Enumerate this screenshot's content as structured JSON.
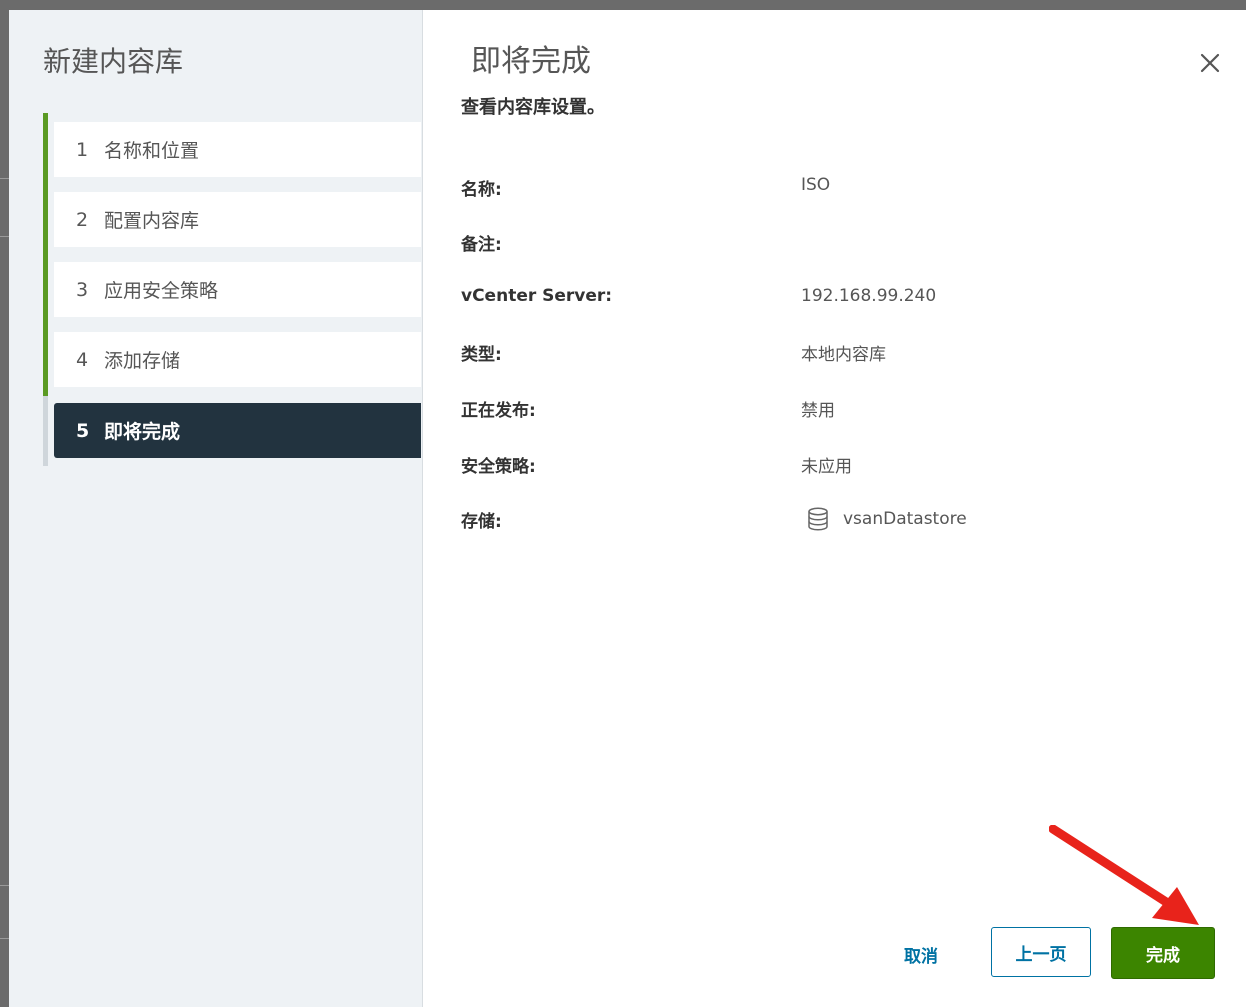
{
  "wizard": {
    "title": "新建内容库",
    "steps": [
      {
        "num": "1",
        "label": "名称和位置"
      },
      {
        "num": "2",
        "label": "配置内容库"
      },
      {
        "num": "3",
        "label": "应用安全策略"
      },
      {
        "num": "4",
        "label": "添加存储"
      },
      {
        "num": "5",
        "label": "即将完成"
      }
    ],
    "active_step": 5
  },
  "content": {
    "title": "即将完成",
    "subtitle": "查看内容库设置。",
    "rows": [
      {
        "label": "名称:",
        "value": "ISO"
      },
      {
        "label": "备注:",
        "value": ""
      },
      {
        "label": "vCenter Server:",
        "value": "192.168.99.240"
      },
      {
        "label": "类型:",
        "value": "本地内容库"
      },
      {
        "label": "正在发布:",
        "value": "禁用"
      },
      {
        "label": "安全策略:",
        "value": "未应用"
      },
      {
        "label": "存储:",
        "value": "vsanDatastore",
        "icon": "datastore-icon"
      }
    ]
  },
  "footer": {
    "cancel_label": "取消",
    "back_label": "上一页",
    "finish_label": "完成"
  },
  "annotation": {
    "arrow_color": "#e8231b",
    "target": "finish-button"
  },
  "colors": {
    "accent_green": "#3c8500",
    "progress_green": "#5a9a23",
    "active_step_bg": "#22333f",
    "link_blue": "#0072a3"
  }
}
